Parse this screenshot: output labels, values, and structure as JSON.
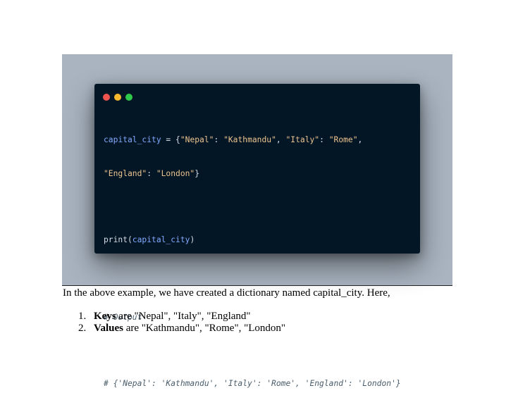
{
  "code": {
    "line1": {
      "var": "capital_city",
      "eq": " = ",
      "open": "{",
      "k1": "\"Nepal\"",
      "sep1": ": ",
      "v1": "\"Kathmandu\"",
      "comma1": ", ",
      "k2": "\"Italy\"",
      "sep2": ": ",
      "v2": "\"Rome\"",
      "comma2": ","
    },
    "line2": {
      "k3": "\"England\"",
      "sep3": ": ",
      "v3": "\"London\"",
      "close": "}"
    },
    "line3": {
      "fn": "print(",
      "arg": "capital_city",
      "close": ")"
    },
    "comment1": "# Output",
    "comment2": "# {'Nepal': 'Kathmandu', 'Italy': 'Rome', 'England': 'London'}"
  },
  "paragraph": "In the above example, we have created a dictionary named capital_city. Here,",
  "list": [
    {
      "num": "1.",
      "term": "Keys",
      "rest": " are \"Nepal\", \"Italy\", \"England\""
    },
    {
      "num": "2.",
      "term": "Values",
      "rest": " are \"Kathmandu\", \"Rome\", \"London\""
    }
  ]
}
